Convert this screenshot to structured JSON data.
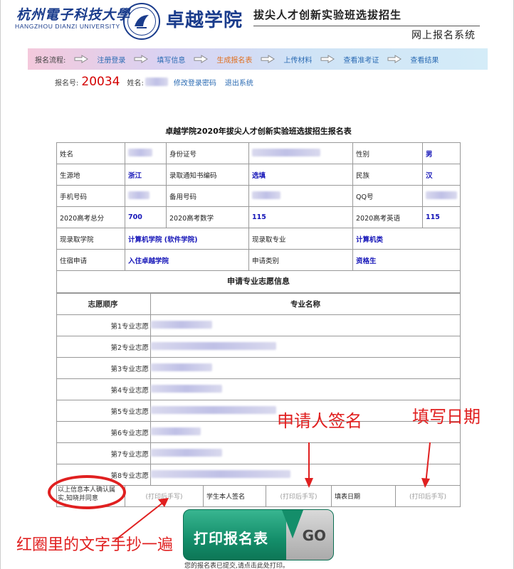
{
  "header": {
    "university_cn": "杭州電子科技大學",
    "university_en": "HANGZHOU DIANZI UNIVERSITY",
    "college": "卓越学院",
    "title": "拔尖人才创新实验班选拔招生",
    "subtitle": "网上报名系统"
  },
  "flow": {
    "label": "报名流程:",
    "steps": [
      "注册登录",
      "填写信息",
      "生成报名表",
      "上传材料",
      "查看准考证",
      "查看结果"
    ],
    "active_index": 2,
    "colors": {
      "link": "#2b6bb3",
      "active": "#e07020"
    }
  },
  "account": {
    "number_label": "报名号:",
    "number": "20034",
    "name_label": "姓名:",
    "change_password": "修改登录密码",
    "logout": "退出系统"
  },
  "form": {
    "title": "卓越学院2020年拔尖人才创新实验班选拔招生报名表",
    "rows": {
      "name_label": "姓名",
      "id_label": "身份证号",
      "gender_label": "性别",
      "gender": "男",
      "origin_label": "生源地",
      "origin": "浙江",
      "admission_code_label": "录取通知书编码",
      "admission_code": "选填",
      "ethnicity_label": "民族",
      "ethnicity": "汉",
      "phone_label": "手机号码",
      "backup_phone_label": "备用号码",
      "qq_label": "QQ号",
      "gaokao_total_label": "2020高考总分",
      "gaokao_total": "700",
      "gaokao_math_label": "2020高考数学",
      "gaokao_math": "115",
      "gaokao_english_label": "2020高考英语",
      "gaokao_english": "115",
      "current_college_label": "现录取学院",
      "current_college": "计算机学院 (软件学院)",
      "current_major_label": "现录取专业",
      "current_major": "计算机类",
      "dorm_label": "住宿申请",
      "dorm": "入住卓越学院",
      "apply_type_label": "申请类别",
      "apply_type": "资格生"
    },
    "prefs_title": "申请专业志愿信息",
    "prefs_header": {
      "order": "志愿顺序",
      "major": "专业名称"
    },
    "prefs": [
      "第1专业志愿",
      "第2专业志愿",
      "第3专业志愿",
      "第4专业志愿",
      "第5专业志愿",
      "第6专业志愿",
      "第7专业志愿",
      "第8专业志愿"
    ],
    "sign": {
      "confirm_text": "以上信息本人确认属实,知晓并同意",
      "hint1": "(打印后手写)",
      "student_sign_label": "学生本人签名",
      "hint2": "(打印后手写)",
      "date_label": "填表日期",
      "hint3": "(打印后手写)"
    }
  },
  "annotations": {
    "signature": "申请人签名",
    "date": "填写日期",
    "note": "红圈里的文字手抄一遍",
    "color": "#e02020"
  },
  "print": {
    "label": "打印报名表",
    "go": "GO",
    "note": "您的报名表已提交,请点击此处打印。"
  }
}
